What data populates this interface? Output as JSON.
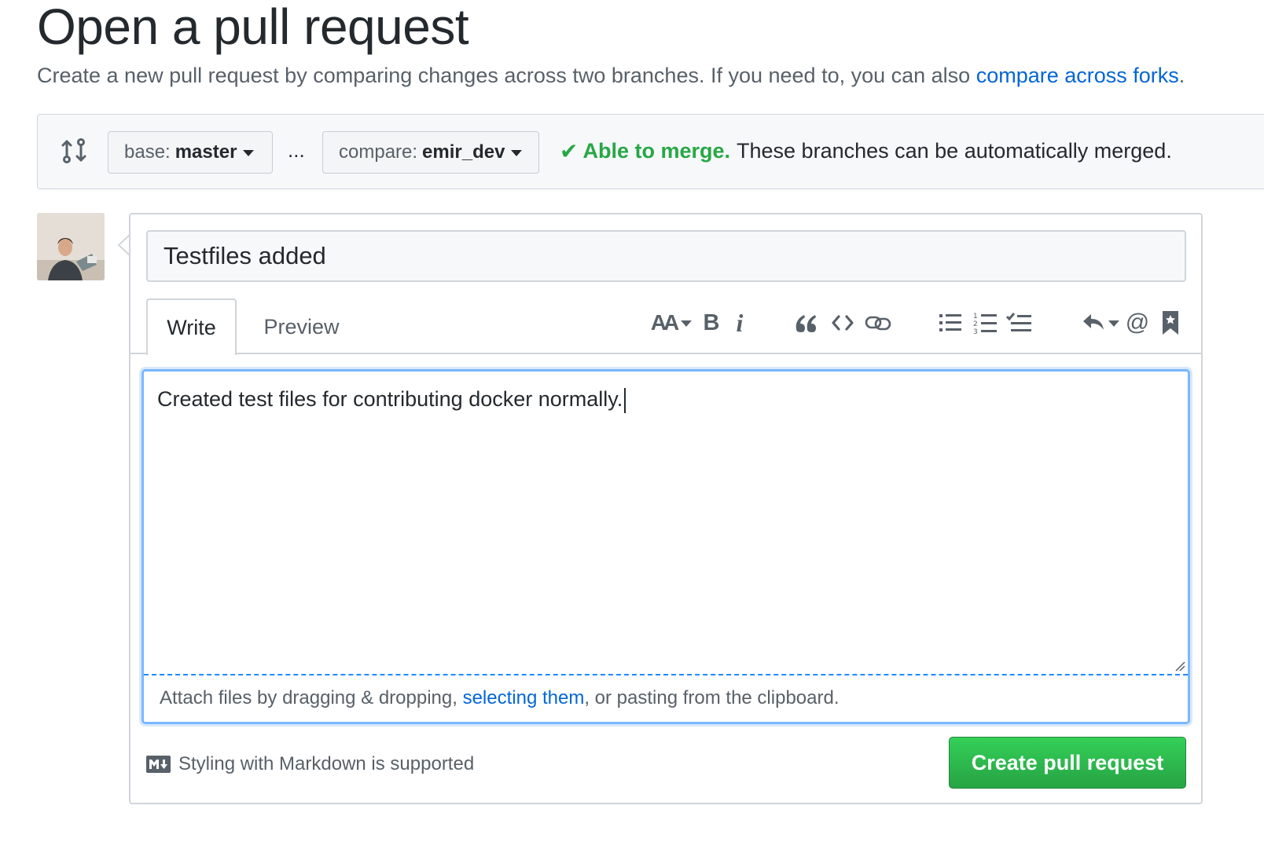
{
  "header": {
    "title": "Open a pull request",
    "subtitle_text": "Create a new pull request by comparing changes across two branches. If you need to, you can also ",
    "subtitle_link": "compare across forks",
    "subtitle_end": "."
  },
  "range": {
    "base_prefix": "base:",
    "base_branch": "master",
    "ellipsis": "...",
    "compare_prefix": "compare:",
    "compare_branch": "emir_dev",
    "merge_ok": "Able to merge.",
    "merge_desc": "These branches can be automatically merged."
  },
  "form": {
    "title_value": "Testfiles added",
    "tabs": [
      {
        "label": "Write"
      },
      {
        "label": "Preview"
      }
    ],
    "toolbar": {
      "header_icon": "text-size-icon",
      "bold_label": "B",
      "italic_label": "i",
      "quote_icon": "quote-icon",
      "code_icon": "code-icon",
      "link_icon": "link-icon",
      "ul_icon": "unordered-list-icon",
      "ol_icon": "ordered-list-icon",
      "task_icon": "tasklist-icon",
      "reply_icon": "reply-icon",
      "mention_label": "@",
      "ref_icon": "bookmark-icon"
    },
    "body_value": "Created test files for contributing docker normally.",
    "attach_text_1": "Attach files by dragging & dropping, ",
    "attach_link": "selecting them",
    "attach_text_2": ", or pasting from the clipboard.",
    "markdown_note": "Styling with Markdown is supported",
    "submit_label": "Create pull request"
  },
  "colors": {
    "accent_blue": "#0366d6",
    "success_green": "#28a745",
    "focus_ring": "#79b8ff",
    "border_gray": "#d1d5da"
  }
}
